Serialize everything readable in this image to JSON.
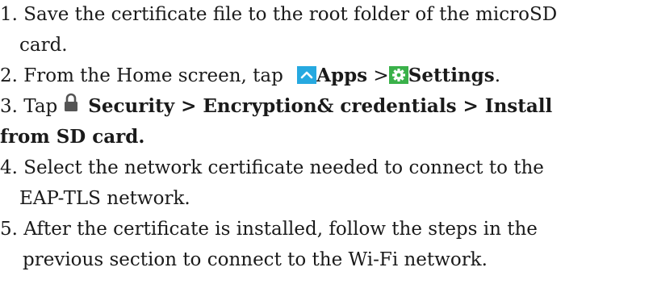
{
  "steps": {
    "s1": {
      "number": "1.",
      "line1": "Save the certificate file to the root folder of the microSD",
      "line2": "card."
    },
    "s2": {
      "number": "2.",
      "prefix": "From the Home screen, tap",
      "apps": "Apps",
      "separator": " >",
      "settings": "Settings",
      "end": "."
    },
    "s3": {
      "number": "3.",
      "prefix": "Tap",
      "bold1": "Security > Encryption& credentials > Install",
      "bold2": "from SD card."
    },
    "s4": {
      "number": "4.",
      "line1": "Select the network certificate needed to connect to the",
      "line2": "EAP-TLS network."
    },
    "s5": {
      "number": "5.",
      "line1": "After the certificate is installed, follow the steps in the",
      "line2": "previous section to connect to the Wi-Fi network."
    }
  },
  "icons": {
    "apps": "chevron-up-icon",
    "settings": "gear-icon",
    "security": "lock-icon"
  },
  "colors": {
    "apps_icon_bg": "#26a9e0",
    "settings_icon_bg": "#3ab14a",
    "lock": "#555555"
  }
}
